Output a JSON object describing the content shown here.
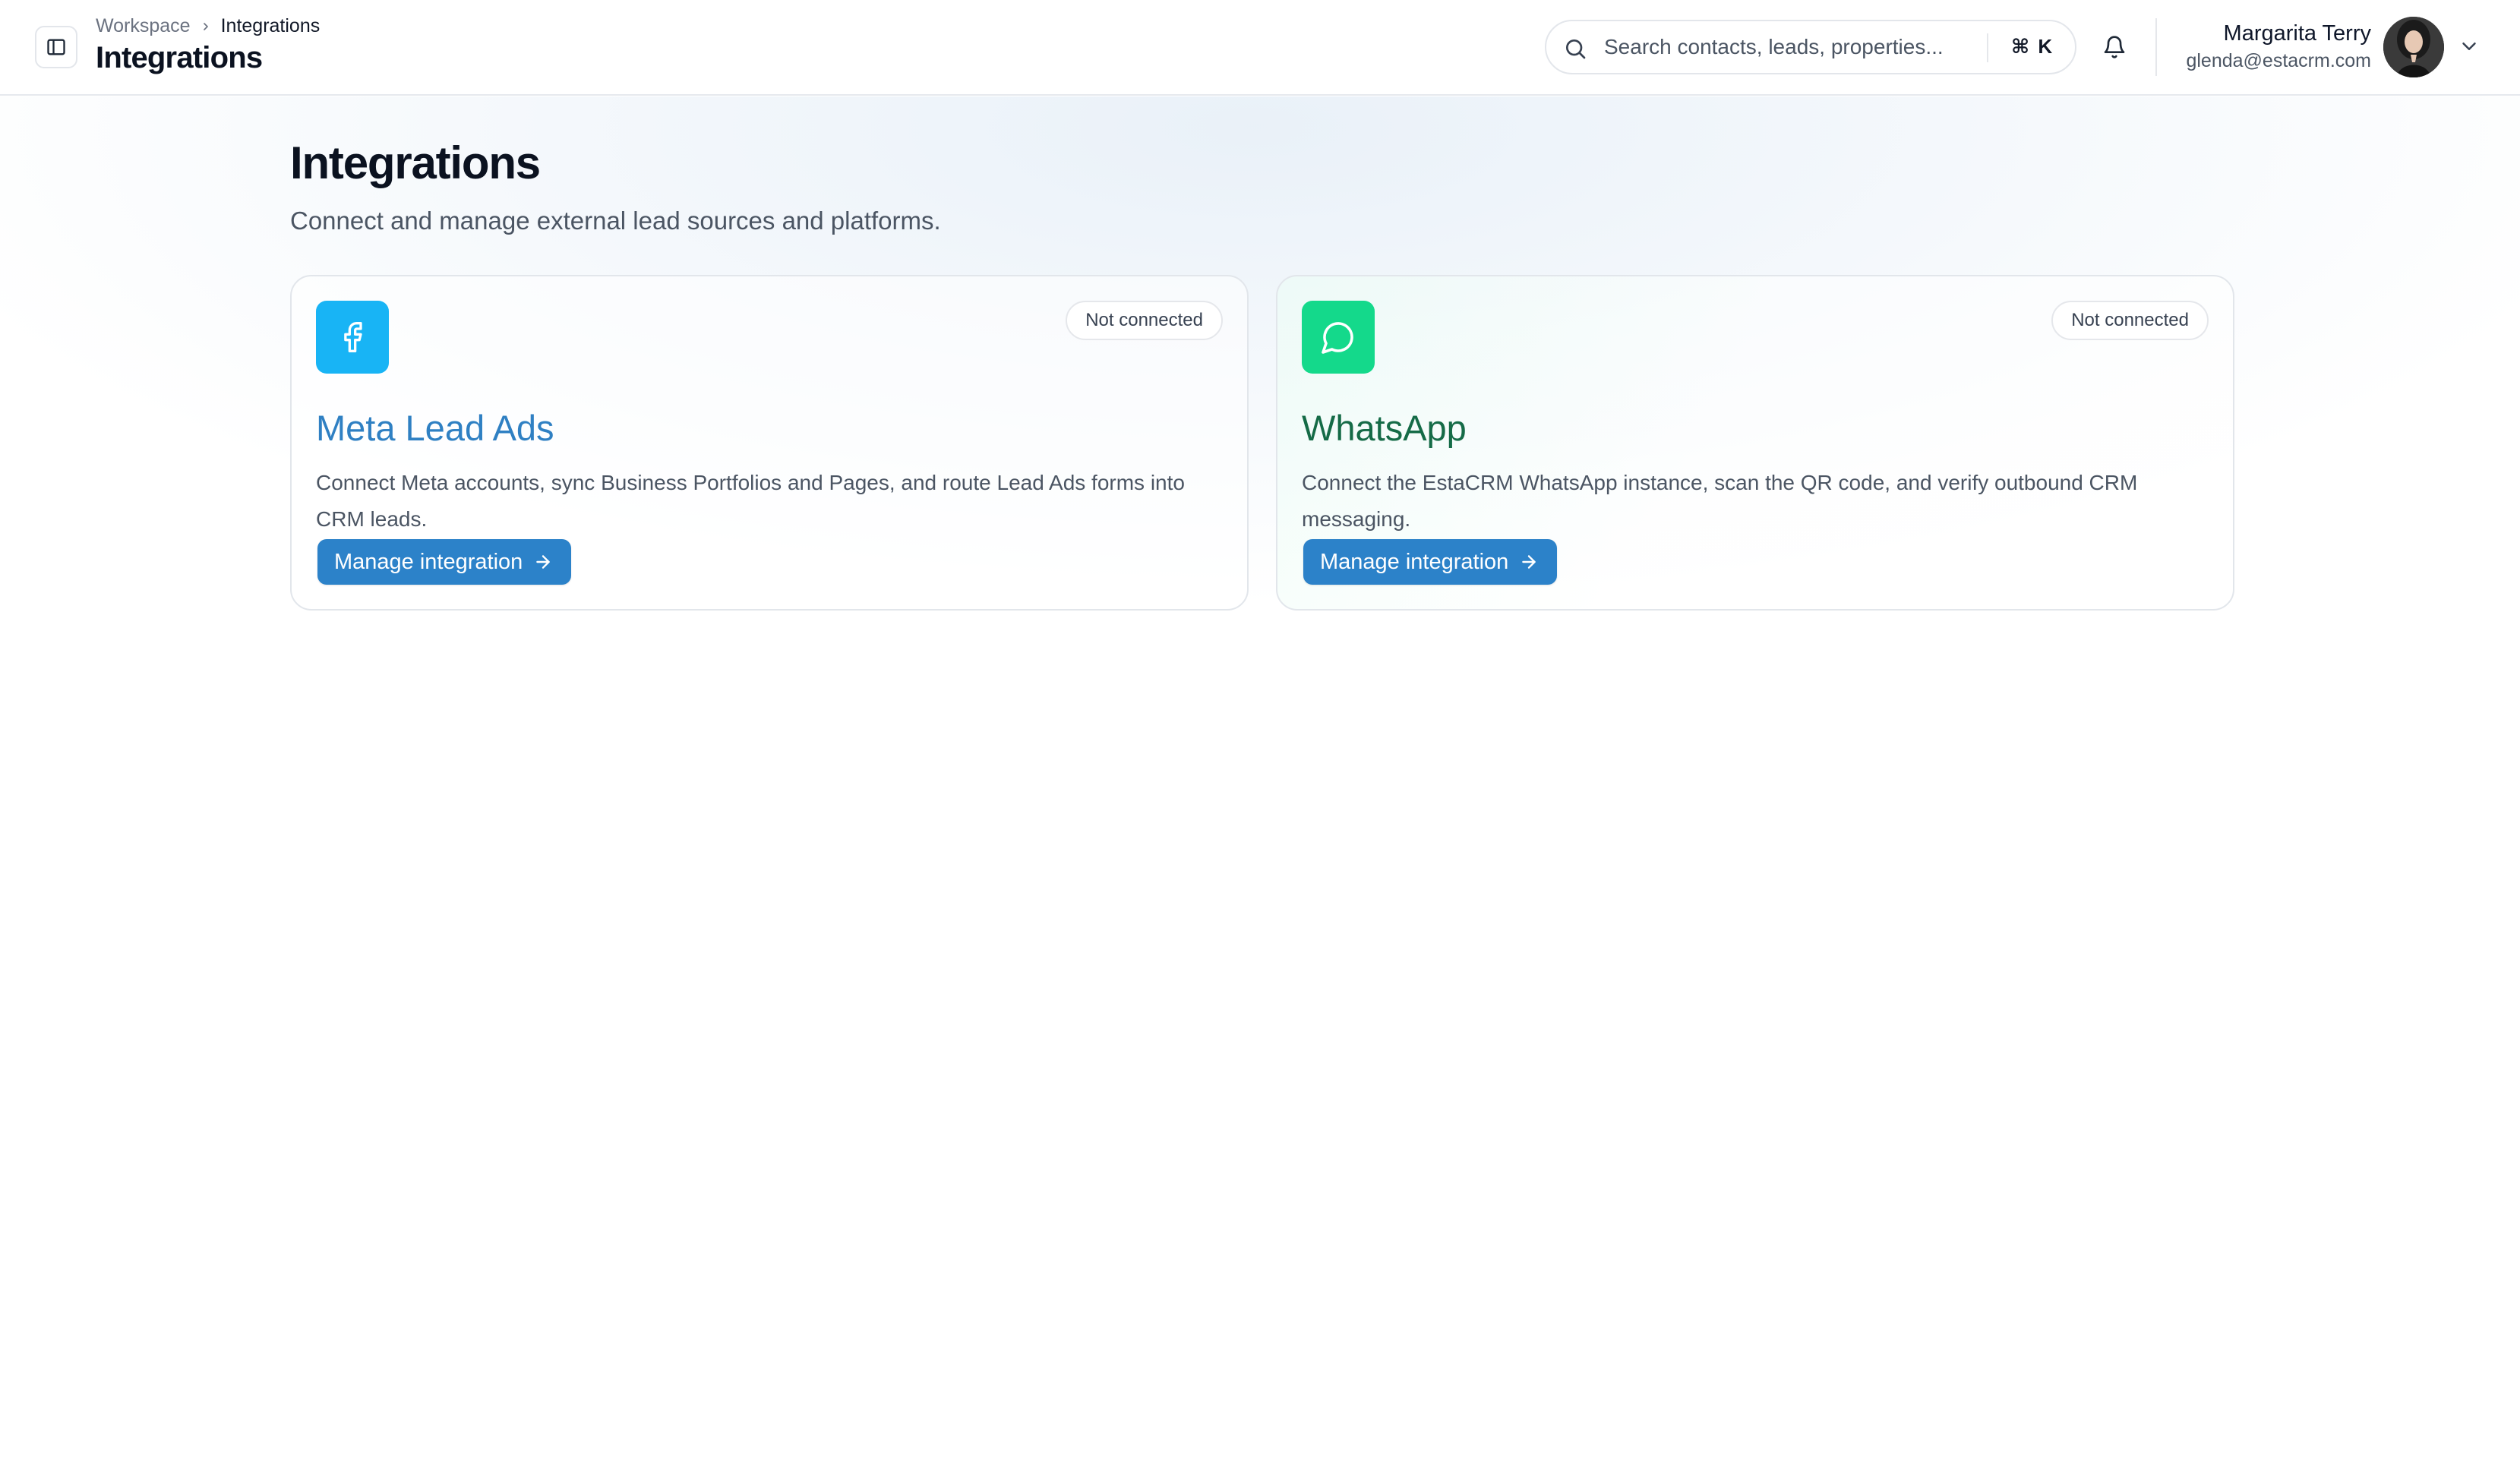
{
  "header": {
    "breadcrumb": {
      "parent": "Workspace",
      "current": "Integrations"
    },
    "title": "Integrations",
    "search": {
      "placeholder": "Search contacts, leads, properties...",
      "shortcut": "⌘ K"
    },
    "user": {
      "name": "Margarita Terry",
      "email": "glenda@estacrm.com"
    }
  },
  "main": {
    "title": "Integrations",
    "subtitle": "Connect and manage external lead sources and platforms.",
    "cards": [
      {
        "title": "Meta Lead Ads",
        "status": "Not connected",
        "description": "Connect Meta accounts, sync Business Portfolios and Pages, and route Lead Ads forms into CRM leads.",
        "action_label": "Manage integration",
        "icon": "facebook-icon",
        "accent": "#18b4f5"
      },
      {
        "title": "WhatsApp",
        "status": "Not connected",
        "description": "Connect the EstaCRM WhatsApp instance, scan the QR code, and verify outbound CRM messaging.",
        "action_label": "Manage integration",
        "icon": "whatsapp-icon",
        "accent": "#14d98b"
      }
    ]
  },
  "colors": {
    "primary_button": "#2c82c9",
    "meta_title": "#2f80c3",
    "whatsapp_title": "#156b47"
  }
}
